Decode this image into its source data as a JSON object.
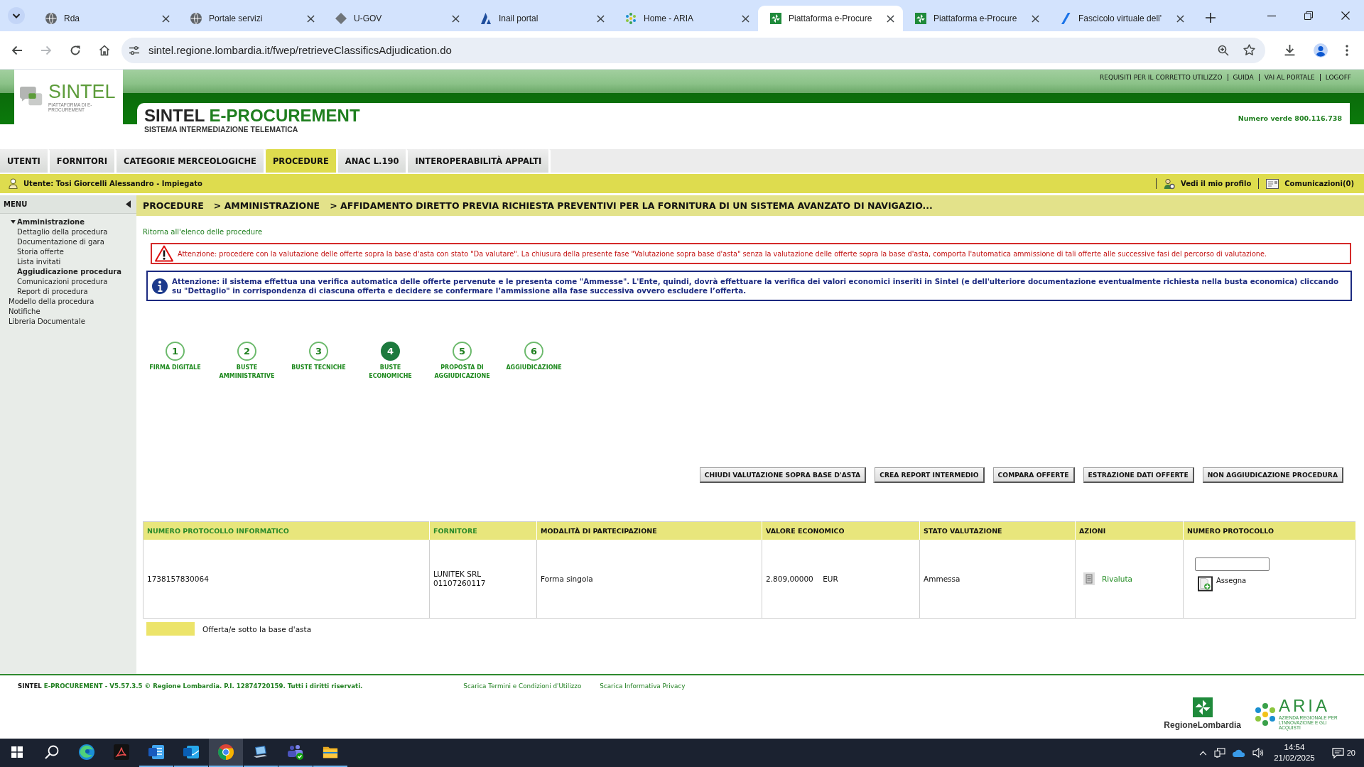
{
  "browser": {
    "tabs": [
      {
        "kind": "globe",
        "title": "Rda",
        "selected": false
      },
      {
        "kind": "globe",
        "title": "Portale servizi",
        "selected": false
      },
      {
        "kind": "ugov",
        "title": "U-GOV",
        "selected": false
      },
      {
        "kind": "inail",
        "title": "Inail portal",
        "selected": false
      },
      {
        "kind": "aria",
        "title": "Home - ARIA",
        "selected": false
      },
      {
        "kind": "region",
        "title": "Piattaforma e-Procure",
        "selected": true
      },
      {
        "kind": "region",
        "title": "Piattaforma e-Procure",
        "selected": false
      },
      {
        "kind": "fascicolo",
        "title": "Fascicolo virtuale dell'",
        "selected": false
      }
    ],
    "address": "sintel.regione.lombardia.it/fwep/retrieveClassificsAdjudication.do"
  },
  "header": {
    "logo": "SINTEL",
    "logo_caption": "PIATTAFORMA DI E-PROCUREMENT",
    "links": [
      "REQUISITI PER IL CORRETTO UTILIZZO",
      "GUIDA",
      "VAI AL PORTALE",
      "LOGOFF"
    ],
    "title_brand": "SINTEL",
    "title_product": "E-PROCUREMENT",
    "subtitle": "SISTEMA INTERMEDIAZIONE TELEMATICA",
    "hotline": "Numero verde 800.116.738"
  },
  "nav": [
    {
      "label": "UTENTI",
      "selected": false
    },
    {
      "label": "FORNITORI",
      "selected": false
    },
    {
      "label": "CATEGORIE MERCEOLOGICHE",
      "selected": false
    },
    {
      "label": "PROCEDURE",
      "selected": true
    },
    {
      "label": "ANAC L.190",
      "selected": false
    },
    {
      "label": "INTEROPERABILITÀ APPALTI",
      "selected": false
    }
  ],
  "user_bar": {
    "user": "Utente: Tosi Giorcelli Alessandro - Impiegato",
    "profile": "Vedi il mio profilo",
    "messages": "Comunicazioni(0)"
  },
  "sidebar": {
    "title": "MENU",
    "items": [
      {
        "label": "Amministrazione",
        "expanded": true,
        "children": [
          {
            "label": "Dettaglio della procedura",
            "selected": false
          },
          {
            "label": "Documentazione di gara",
            "selected": false
          },
          {
            "label": "Storia offerte",
            "selected": false
          },
          {
            "label": "Lista invitati",
            "selected": false
          },
          {
            "label": "Aggiudicazione procedura",
            "selected": true
          },
          {
            "label": "Comunicazioni procedura",
            "selected": false
          },
          {
            "label": "Report di procedura",
            "selected": false
          }
        ]
      },
      {
        "label": "Modello della procedura",
        "expanded": false
      },
      {
        "label": "Notifiche",
        "expanded": false
      },
      {
        "label": "Libreria Documentale",
        "expanded": false
      }
    ]
  },
  "breadcrumb": [
    "PROCEDURE",
    "> AMMINISTRAZIONE",
    "> AFFIDAMENTO DIRETTO PREVIA RICHIESTA PREVENTIVI PER LA FORNITURA DI UN SISTEMA AVANZATO DI NAVIGAZIO..."
  ],
  "back_link": "Ritorna all'elenco delle procedure",
  "alerts": [
    {
      "kind": "warning",
      "text": "Attenzione: procedere con la valutazione delle offerte sopra la base d'asta con stato \"Da valutare\". La chiusura della presente fase \"Valutazione sopra base d'asta\" senza la valutazione delle offerte sopra la base d'asta, comporta l'automatica ammissione di tali offerte alle successive fasi del percorso di valutazione."
    },
    {
      "kind": "info",
      "text": "Attenzione: il sistema effettua una verifica automatica delle offerte pervenute e le presenta come \"Ammesse\". L'Ente, quindi, dovrà effettuare la verifica dei valori economici inseriti in Sintel (e dell'ulteriore documentazione eventualmente richiesta nella busta economica) cliccando su \"Dettaglio\" in corrispondenza di ciascuna offerta e decidere se confermare l’ammissione alla fase successiva ovvero escludere l’offerta."
    }
  ],
  "steps": [
    {
      "number": "1",
      "label": "FIRMA DIGITALE",
      "selected": false
    },
    {
      "number": "2",
      "label": "BUSTE AMMINISTRATIVE",
      "selected": false
    },
    {
      "number": "3",
      "label": "BUSTE TECNICHE",
      "selected": false
    },
    {
      "number": "4",
      "label": "BUSTE ECONOMICHE",
      "selected": true
    },
    {
      "number": "5",
      "label": "PROPOSTA DI AGGIUDICAZIONE",
      "selected": false
    },
    {
      "number": "6",
      "label": "AGGIUDICAZIONE",
      "selected": false
    }
  ],
  "actions": [
    "CHIUDI VALUTAZIONE SOPRA BASE D'ASTA",
    "CREA REPORT INTERMEDIO",
    "COMPARA OFFERTE",
    "ESTRAZIONE DATI OFFERTE",
    "NON AGGIUDICAZIONE PROCEDURA"
  ],
  "table": {
    "columns": [
      {
        "label": "NUMERO PROTOCOLLO INFORMATICO",
        "link": true
      },
      {
        "label": "FORNITORE",
        "link": true
      },
      {
        "label": "MODALITÀ DI PARTECIPAZIONE",
        "link": false
      },
      {
        "label": "VALORE ECONOMICO",
        "link": false
      },
      {
        "label": "STATO VALUTAZIONE",
        "link": false
      },
      {
        "label": "AZIONI",
        "link": false
      },
      {
        "label": "NUMERO PROTOCOLLO",
        "link": false
      }
    ],
    "rows": [
      {
        "below_base": false,
        "protocol": "1738157830064",
        "supplier": [
          "LUNITEK SRL",
          "01107260117"
        ],
        "participation": "Forma singola",
        "amount": "2.809,00000",
        "currency": "EUR",
        "status": "Ammessa",
        "action": "Rivaluta",
        "assign": "Assegna"
      }
    ]
  },
  "legend": "Offerta/e sotto la base d'asta",
  "footer": {
    "brand": "SINTEL",
    "notice": "E-PROCUREMENT - V5.57.3.5 © Regione Lombardia. P.I. 12874720159. Tutti i diritti riservati.",
    "links": [
      "Scarica Termini e Condizioni d'Utilizzo",
      "Scarica Informativa Privacy"
    ],
    "region_logo": "RegioneLombardia",
    "aria_logo": "ARIA",
    "aria_caption": "AZIENDA REGIONALE PER L'INNOVAZIONE E GLI ACQUISTI"
  },
  "taskbar": {
    "apps": [
      {
        "kind": "start",
        "running": false,
        "selected": false
      },
      {
        "kind": "search",
        "running": false,
        "selected": false
      },
      {
        "kind": "edge",
        "running": false,
        "selected": false
      },
      {
        "kind": "acrobat",
        "running": false,
        "selected": false
      },
      {
        "kind": "word",
        "running": true,
        "selected": false
      },
      {
        "kind": "outlook",
        "running": true,
        "selected": false
      },
      {
        "kind": "chrome",
        "running": true,
        "selected": true
      },
      {
        "kind": "remote",
        "running": true,
        "selected": false
      },
      {
        "kind": "teams",
        "running": true,
        "selected": false
      },
      {
        "kind": "explorer",
        "running": true,
        "selected": false
      }
    ],
    "time": "14:54",
    "date": "21/02/2025",
    "notifications": "20"
  }
}
